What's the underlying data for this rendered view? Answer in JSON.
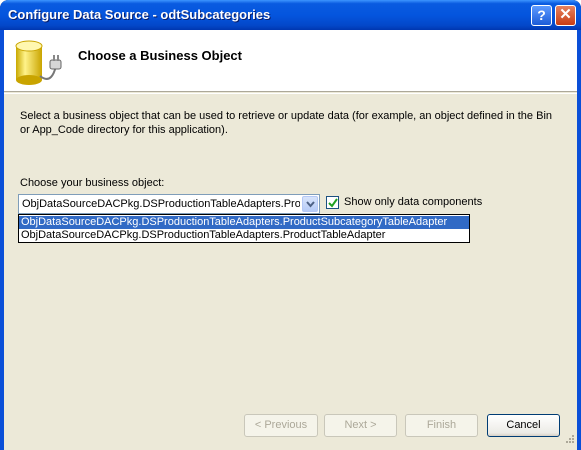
{
  "window": {
    "title": "Configure Data Source - odtSubcategories",
    "help_glyph": "?",
    "close_glyph": "✕"
  },
  "header": {
    "title": "Choose a Business Object",
    "icon": "database-plug-icon"
  },
  "description": "Select a business object that can be used to retrieve or update data (for example, an object defined in the Bin or App_Code directory for this application).",
  "business_object": {
    "label": "Choose your business object:",
    "selected_value": "ObjDataSourceDACPkg.DSProductionTableAdapters.ProductSubcategoryTableAdapter",
    "options": [
      "ObjDataSourceDACPkg.DSProductionTableAdapters.ProductSubcategoryTableAdapter",
      "ObjDataSourceDACPkg.DSProductionTableAdapters.ProductTableAdapter"
    ]
  },
  "show_only_data_components": {
    "label": "Show only data components",
    "checked": true
  },
  "buttons": {
    "previous": "< Previous",
    "next": "Next >",
    "finish": "Finish",
    "cancel": "Cancel"
  },
  "colors": {
    "title_bar": "#0455de",
    "selection": "#316ac5",
    "dialog_face": "#ece9d8"
  }
}
